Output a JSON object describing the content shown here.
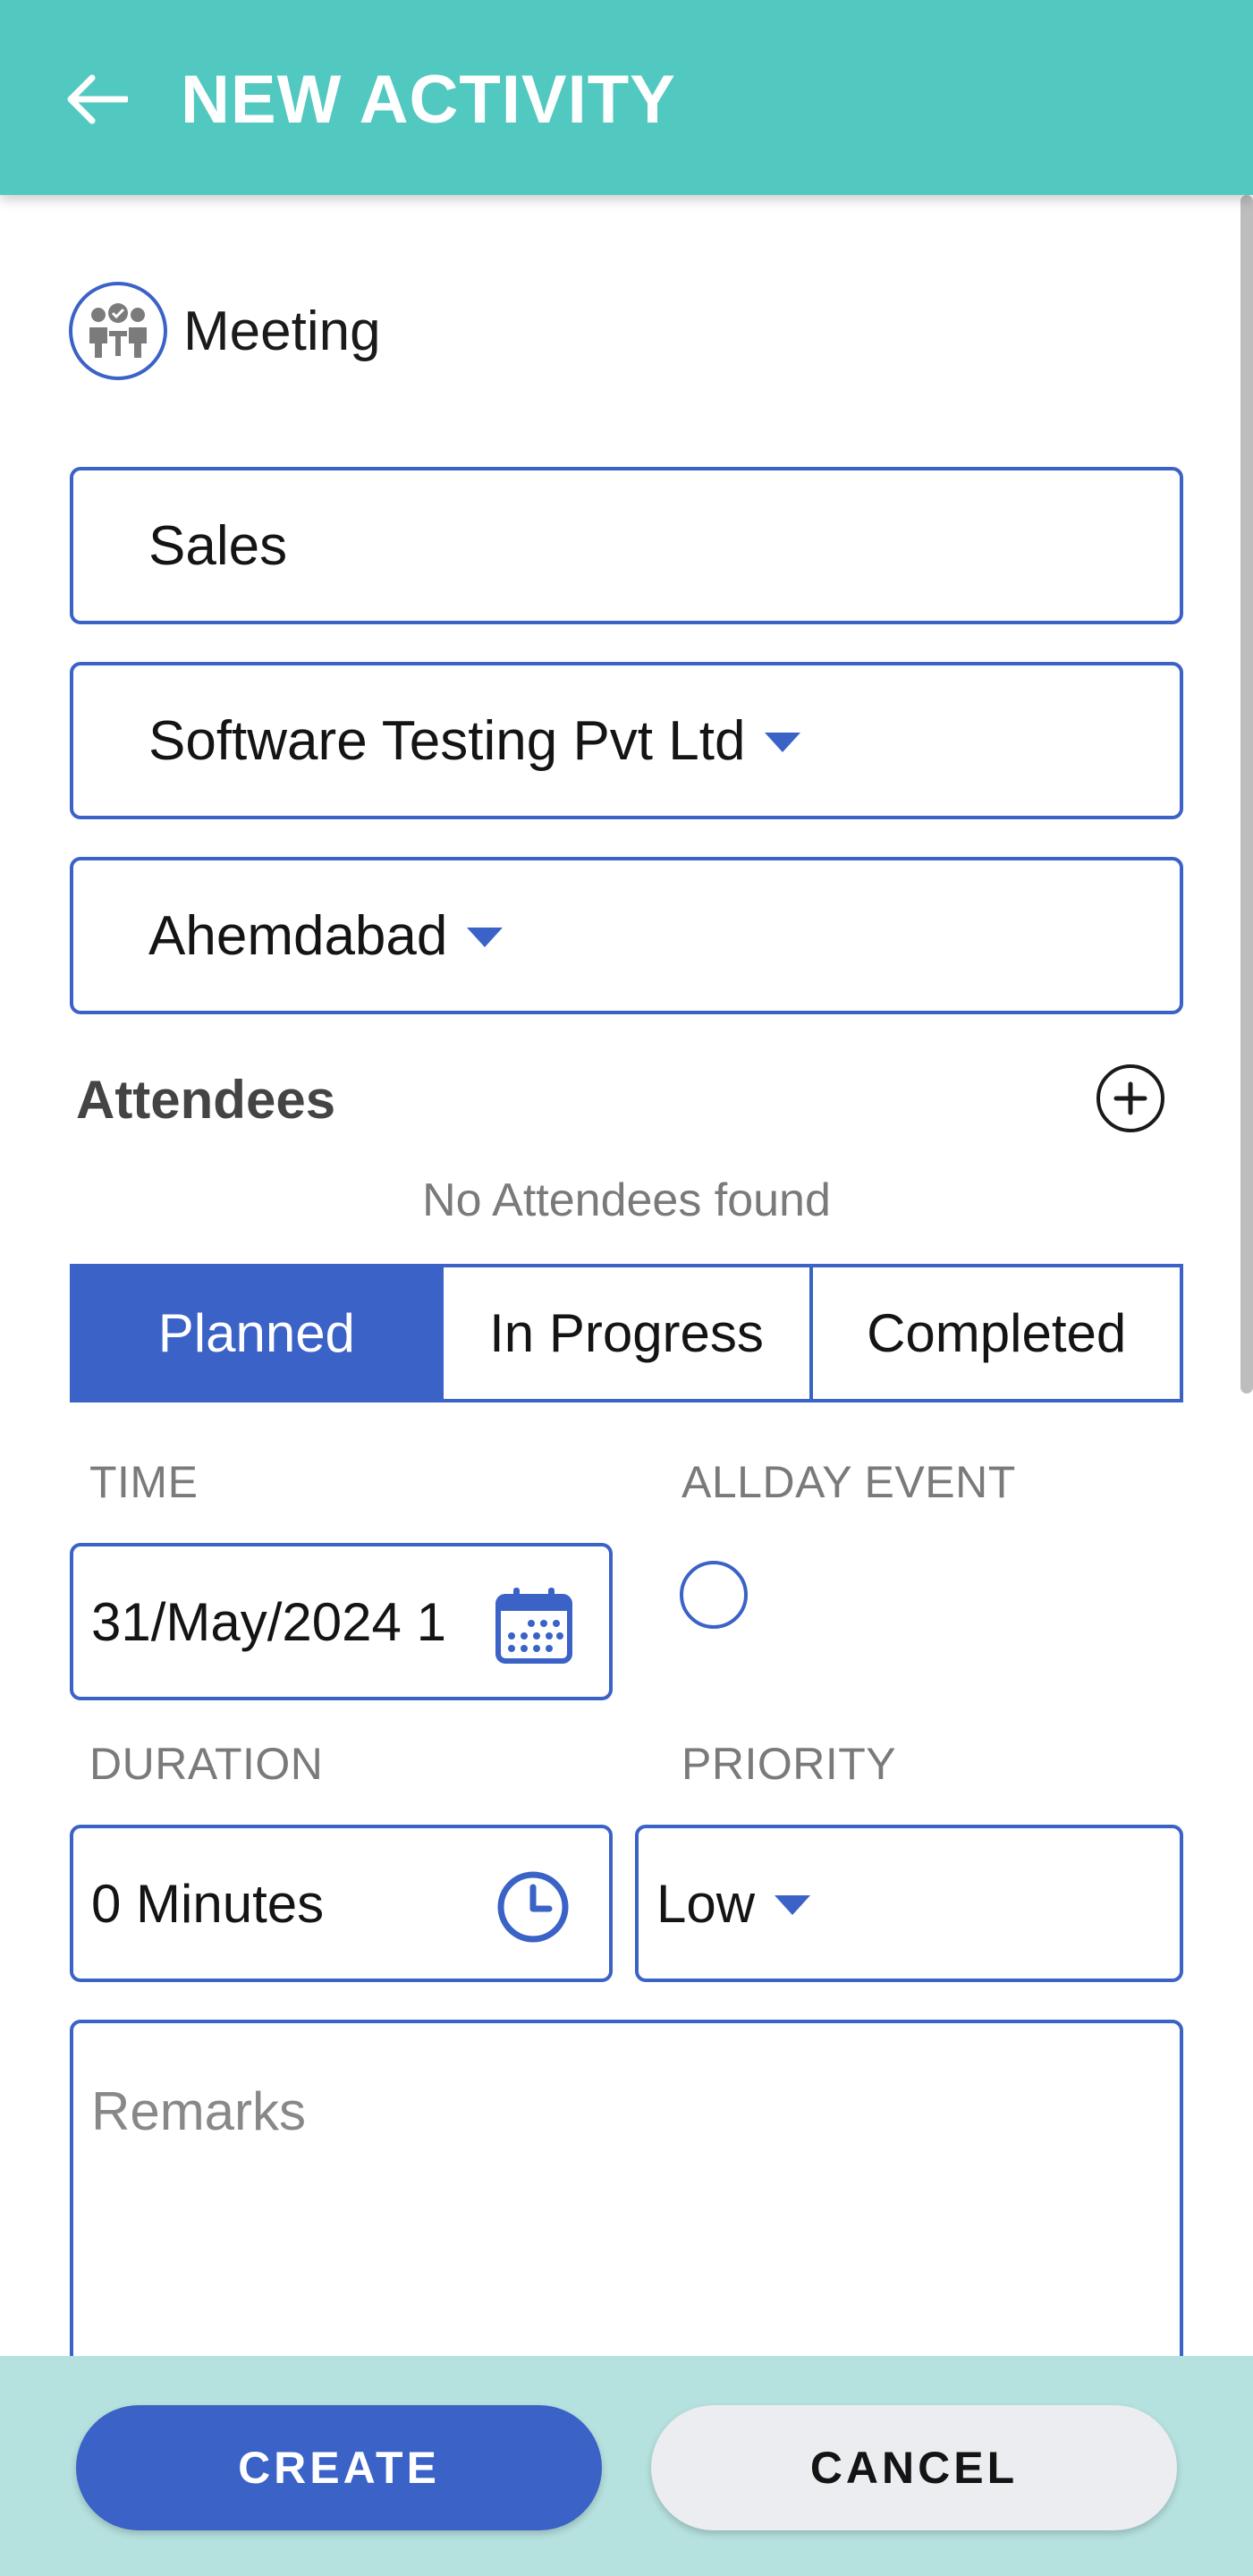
{
  "header": {
    "title": "NEW ACTIVITY",
    "back_icon": "arrow-left-icon"
  },
  "activity_type": {
    "label": "Meeting",
    "icon": "meeting-people-icon"
  },
  "fields": {
    "category": "Sales",
    "company": "Software Testing Pvt Ltd",
    "location": "Ahemdabad"
  },
  "attendees": {
    "title": "Attendees",
    "empty_text": "No Attendees found",
    "add_icon": "plus-circle-icon"
  },
  "status": {
    "options": [
      "Planned",
      "In Progress",
      "Completed"
    ],
    "selected": "Planned"
  },
  "time": {
    "label": "TIME",
    "value": "31/May/2024 1",
    "icon": "calendar-icon"
  },
  "allday": {
    "label": "ALLDAY EVENT",
    "checked": false
  },
  "duration": {
    "label": "DURATION",
    "value": "0 Minutes",
    "icon": "clock-icon"
  },
  "priority": {
    "label": "PRIORITY",
    "value": "Low"
  },
  "remarks": {
    "placeholder": "Remarks",
    "value": ""
  },
  "actions": {
    "create": "CREATE",
    "cancel": "CANCEL"
  },
  "colors": {
    "header": "#52c9c0",
    "accent": "#3a62c7",
    "footer": "#b5e1de"
  }
}
